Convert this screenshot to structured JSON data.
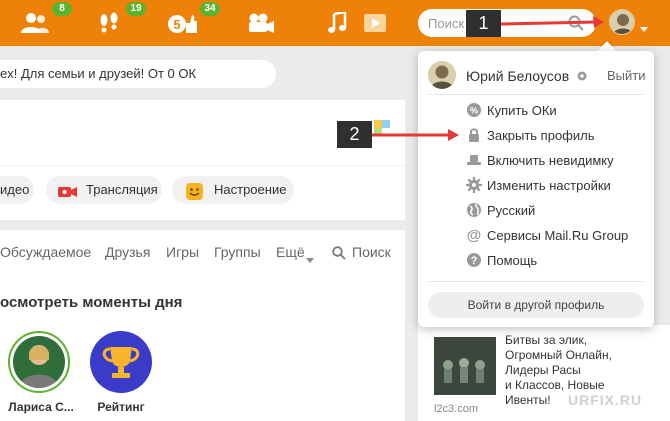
{
  "topbar": {
    "badges": {
      "friends": "8",
      "guests": "19",
      "marks": "34"
    },
    "search_placeholder": "Поиск",
    "accent_color": "#ee8208",
    "badge_color": "#5cb32e"
  },
  "annotations": {
    "step1": "1",
    "step2": "2",
    "arrow_color": "#e53935"
  },
  "promo": {
    "text": "ex! Для семьи и друзей! От 0 ОК"
  },
  "post_actions": {
    "video": "идео",
    "broadcast": "Трансляция",
    "mood": "Настроение"
  },
  "feed": {
    "tabs": [
      "Обсуждаемое",
      "Друзья",
      "Игры",
      "Группы",
      "Ещё"
    ],
    "search_label": "Поиск",
    "section_title": "осмотреть моменты дня",
    "stories": [
      {
        "label": "Лариса С..."
      },
      {
        "label": "Рейтинг"
      }
    ]
  },
  "dropdown": {
    "user_name": "Юрий Белоусов",
    "logout": "Выйти",
    "items": [
      {
        "label": "Купить ОКи",
        "icon": "ok-coin-icon"
      },
      {
        "label": "Закрыть профиль",
        "icon": "lock-icon"
      },
      {
        "label": "Включить невидимку",
        "icon": "hat-icon"
      },
      {
        "label": "Изменить настройки",
        "icon": "gear-icon"
      },
      {
        "label": "Русский",
        "icon": "globe-icon"
      },
      {
        "label": "Сервисы Mail.Ru Group",
        "icon": "at-icon"
      },
      {
        "label": "Помощь",
        "icon": "help-icon"
      }
    ],
    "switch_profile": "Войти в другой профиль"
  },
  "ad": {
    "lines": [
      "Битвы за элик,",
      "Огромный Онлайн,",
      "Лидеры Расы",
      "и Классов, Новые",
      "Ивенты!"
    ],
    "domain": "l2c3.com"
  },
  "watermark": "URFIX.RU"
}
